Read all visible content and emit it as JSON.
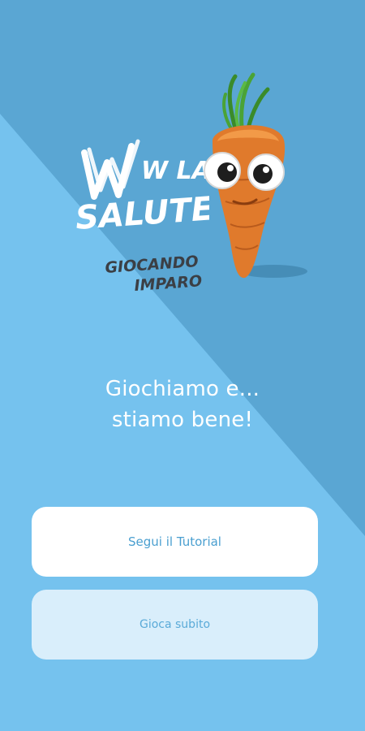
{
  "logo": {
    "brand_line1": "W LA",
    "brand_line2": "SALUTE",
    "sub_line1": "GIOCANDO",
    "sub_line2": "IMPARO"
  },
  "mascot": {
    "icon": "carrot-mascot-icon"
  },
  "tagline": {
    "line1": "Giochiamo e...",
    "line2": "stiamo bene!"
  },
  "buttons": {
    "tutorial_label": "Segui il Tutorial",
    "play_label": "Gioca subito"
  },
  "colors": {
    "background_light": "#75c2ee",
    "background_dark": "#5aa6d3",
    "button_primary": "#ffffff",
    "button_secondary": "#d9eefb",
    "button_text": "#4a9fd0"
  }
}
